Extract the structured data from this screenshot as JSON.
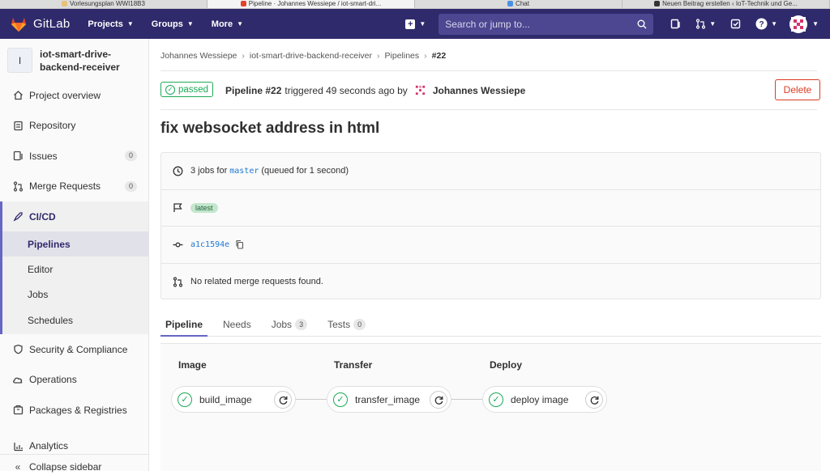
{
  "browser_tabs": [
    {
      "label": "Vorlesungsplan WWI18B3",
      "active": false
    },
    {
      "label": "Pipeline · Johannes Wessiepe / iot-smart-dri...",
      "active": true
    },
    {
      "label": "Chat",
      "active": false
    },
    {
      "label": "Neuen Beitrag erstellen ‹ IoT-Technik und Ge...",
      "active": false
    }
  ],
  "topbar": {
    "brand": "GitLab",
    "nav": [
      {
        "label": "Projects"
      },
      {
        "label": "Groups"
      },
      {
        "label": "More"
      }
    ],
    "search_placeholder": "Search or jump to...",
    "colors": {
      "bar": "#2f2a6b",
      "search": "#4c4790"
    }
  },
  "sidebar": {
    "project_avatar": "I",
    "project_name": "iot-smart-drive-backend-receiver",
    "items": [
      {
        "label": "Project overview",
        "icon": "home-icon"
      },
      {
        "label": "Repository",
        "icon": "document-icon"
      },
      {
        "label": "Issues",
        "icon": "issues-icon",
        "count": "0"
      },
      {
        "label": "Merge Requests",
        "icon": "merge-request-icon",
        "count": "0"
      }
    ],
    "cicd": {
      "label": "CI/CD",
      "sub": [
        {
          "label": "Pipelines",
          "active": true
        },
        {
          "label": "Editor",
          "active": false
        },
        {
          "label": "Jobs",
          "active": false
        },
        {
          "label": "Schedules",
          "active": false
        }
      ]
    },
    "items_after": [
      {
        "label": "Security & Compliance",
        "icon": "shield-icon"
      },
      {
        "label": "Operations",
        "icon": "cloud-icon"
      },
      {
        "label": "Packages & Registries",
        "icon": "package-icon"
      },
      {
        "label": "Analytics",
        "icon": "chart-icon"
      }
    ],
    "collapse_label": "Collapse sidebar"
  },
  "breadcrumb": [
    "Johannes Wessiepe",
    "iot-smart-drive-backend-receiver",
    "Pipelines",
    "#22"
  ],
  "pipeline": {
    "status": "passed",
    "id_label": "Pipeline #22",
    "triggered_text": "triggered 49 seconds ago by",
    "user": "Johannes Wessiepe",
    "delete_label": "Delete",
    "commit_title": "fix websocket address in html",
    "jobs_prefix": "3 jobs for",
    "branch": "master",
    "jobs_suffix": "(queued for 1 second)",
    "tag": "latest",
    "sha": "a1c1594e",
    "merge_requests_text": "No related merge requests found."
  },
  "tabs": [
    {
      "label": "Pipeline",
      "active": true
    },
    {
      "label": "Needs",
      "active": false
    },
    {
      "label": "Jobs",
      "count": "3",
      "active": false
    },
    {
      "label": "Tests",
      "count": "0",
      "active": false
    }
  ],
  "stages": [
    {
      "title": "Image",
      "job": "build_image"
    },
    {
      "title": "Transfer",
      "job": "transfer_image"
    },
    {
      "title": "Deploy",
      "job": "deploy image"
    }
  ],
  "colors": {
    "success": "#1aaa55",
    "danger": "#db3b21",
    "link": "#1f78d1",
    "accent": "#6666c4"
  }
}
